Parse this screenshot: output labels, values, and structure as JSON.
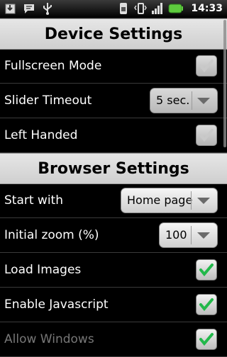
{
  "status_bar": {
    "time": "14:33",
    "icons_left": [
      "download-icon",
      "chat-icon",
      "usb-icon"
    ],
    "icons_right": [
      "sim-icon",
      "vibrate-icon",
      "signal-icon",
      "battery-icon"
    ]
  },
  "device_section": {
    "title": "Device Settings",
    "rows": [
      {
        "label": "Fullscreen Mode",
        "control": "checkbox",
        "checked": false,
        "enabled": false
      },
      {
        "label": "Slider Timeout",
        "control": "spinner",
        "value": "5 sec."
      },
      {
        "label": "Left Handed",
        "control": "checkbox",
        "checked": false,
        "enabled": false
      }
    ]
  },
  "browser_section": {
    "title": "Browser Settings",
    "rows": [
      {
        "label": "Start with",
        "control": "spinner",
        "value": "Home page"
      },
      {
        "label": "Initial zoom (%)",
        "control": "spinner",
        "value": "100"
      },
      {
        "label": "Load Images",
        "control": "checkbox",
        "checked": true,
        "enabled": true
      },
      {
        "label": "Enable Javascript",
        "control": "checkbox",
        "checked": true,
        "enabled": true
      },
      {
        "label": "Allow Windows",
        "control": "checkbox",
        "checked": true,
        "enabled": true
      }
    ]
  },
  "colors": {
    "check_green": "#22b84a",
    "check_disabled": "#c9c9c9",
    "header_bg": "#dcdcdc"
  }
}
